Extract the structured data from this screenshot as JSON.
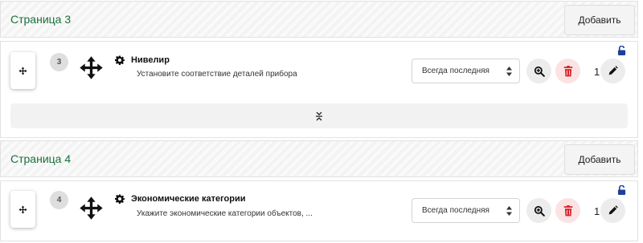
{
  "pages": [
    {
      "title": "Страница 3",
      "add_label": "Добавить",
      "question": {
        "number": "3",
        "title": "Нивелир",
        "description": "Установите соответствие деталей прибора",
        "select_value": "Всегда последняя",
        "count": "1"
      }
    },
    {
      "title": "Страница 4",
      "add_label": "Добавить",
      "question": {
        "number": "4",
        "title": "Экономические категории",
        "description": "Укажите экономические категории объектов, ...",
        "select_value": "Всегда последняя",
        "count": "1"
      }
    }
  ],
  "colors": {
    "page_title": "#19713b",
    "lock": "#1f3f9a",
    "delete_icon": "#d8232a",
    "delete_bg": "#fbe3e3"
  },
  "icons": [
    "move-icon",
    "gear-icon",
    "zoom-in-icon",
    "trash-icon",
    "pencil-icon",
    "unlock-icon",
    "collapse-icon",
    "select-arrows-icon"
  ]
}
